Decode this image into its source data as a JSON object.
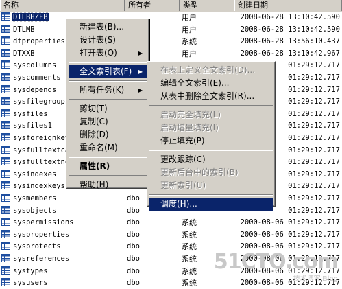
{
  "columns": [
    "名称",
    "所有者",
    "类型",
    "创建日期"
  ],
  "rows": [
    {
      "name": "DTLBHZFB",
      "owner": "",
      "type": "用户",
      "date": "2008-06-28 13:10:42.590",
      "selected": true
    },
    {
      "name": "DTLMB",
      "owner": "",
      "type": "用户",
      "date": "2008-06-28 13:10:42.590"
    },
    {
      "name": "dtproperties",
      "owner": "",
      "type": "系统",
      "date": "2008-06-28 13:56:10.437"
    },
    {
      "name": "DTXXB",
      "owner": "",
      "type": "用户",
      "date": "2008-06-28 13:10:42.967"
    },
    {
      "name": "syscolumns",
      "owner": "",
      "type": "",
      "date": "01:29:12.717"
    },
    {
      "name": "syscomments",
      "owner": "",
      "type": "",
      "date": "01:29:12.717"
    },
    {
      "name": "sysdepends",
      "owner": "",
      "type": "",
      "date": "01:29:12.717"
    },
    {
      "name": "sysfilegroups",
      "owner": "",
      "type": "",
      "date": "01:29:12.717"
    },
    {
      "name": "sysfiles",
      "owner": "",
      "type": "",
      "date": "01:29:12.717"
    },
    {
      "name": "sysfiles1",
      "owner": "",
      "type": "",
      "date": "01:29:12.717"
    },
    {
      "name": "sysforeignkey",
      "owner": "",
      "type": "",
      "date": "01:29:12.717"
    },
    {
      "name": "sysfulltextca",
      "owner": "",
      "type": "",
      "date": "01:29:12.717"
    },
    {
      "name": "sysfulltextno",
      "owner": "",
      "type": "",
      "date": "01:29:12.717"
    },
    {
      "name": "sysindexes",
      "owner": "",
      "type": "",
      "date": "01:29:12.717"
    },
    {
      "name": "sysindexkeys",
      "owner": "",
      "type": "",
      "date": "01:29:12.717"
    },
    {
      "name": "sysmembers",
      "owner": "dbo",
      "type": "",
      "date": "01:29:12.717"
    },
    {
      "name": "sysobjects",
      "owner": "dbo",
      "type": "",
      "date": "01:29:12.717"
    },
    {
      "name": "syspermissions",
      "owner": "dbo",
      "type": "系统",
      "date": "2000-08-06 01:29:12.717"
    },
    {
      "name": "sysproperties",
      "owner": "dbo",
      "type": "系统",
      "date": "2000-08-06 01:29:12.717"
    },
    {
      "name": "sysprotects",
      "owner": "dbo",
      "type": "系统",
      "date": "2000-08-06 01:29:12.717"
    },
    {
      "name": "sysreferences",
      "owner": "dbo",
      "type": "系统",
      "date": "2000-08-06 01:29:12.717"
    },
    {
      "name": "systypes",
      "owner": "dbo",
      "type": "系统",
      "date": "2000-08-06 01:29:12.717"
    },
    {
      "name": "sysusers",
      "owner": "dbo",
      "type": "系统",
      "date": "2000-08-06 01:29:12.717"
    }
  ],
  "context_menu": [
    {
      "label": "新建表(B)...",
      "type": "item"
    },
    {
      "label": "设计表(S)",
      "type": "item"
    },
    {
      "label": "打开表(O)",
      "type": "item",
      "submenu": true
    },
    {
      "type": "sep"
    },
    {
      "label": "全文索引表(F)",
      "type": "item",
      "submenu": true,
      "highlighted": true
    },
    {
      "type": "sep"
    },
    {
      "label": "所有任务(K)",
      "type": "item",
      "submenu": true
    },
    {
      "type": "sep"
    },
    {
      "label": "剪切(T)",
      "type": "item"
    },
    {
      "label": "复制(C)",
      "type": "item"
    },
    {
      "label": "删除(D)",
      "type": "item"
    },
    {
      "label": "重命名(M)",
      "type": "item"
    },
    {
      "type": "sep"
    },
    {
      "label": "属性(R)",
      "type": "item",
      "bold": true
    },
    {
      "type": "sep"
    },
    {
      "label": "帮助(H)",
      "type": "item"
    }
  ],
  "fulltext_submenu": [
    {
      "label": "在表上定义全文索引(D)...",
      "type": "item",
      "disabled": true
    },
    {
      "label": "编辑全文索引(E)...",
      "type": "item"
    },
    {
      "label": "从表中删除全文索引(R)...",
      "type": "item"
    },
    {
      "type": "sep"
    },
    {
      "label": "启动完全填充(L)",
      "type": "item",
      "disabled": true
    },
    {
      "label": "启动增量填充(I)",
      "type": "item",
      "disabled": true
    },
    {
      "label": "停止填充(P)",
      "type": "item"
    },
    {
      "type": "sep"
    },
    {
      "label": "更改跟踪(C)",
      "type": "item"
    },
    {
      "label": "更新后台中的索引(B)",
      "type": "item",
      "disabled": true
    },
    {
      "label": "更新索引(U)",
      "type": "item",
      "disabled": true
    },
    {
      "type": "sep"
    },
    {
      "label": "调度(H)...",
      "type": "item",
      "highlighted": true
    }
  ],
  "watermark": {
    "big": "51CTO.com",
    "small": "技术博客 Blog"
  },
  "colors": {
    "highlight": "#0a246a",
    "menu_bg": "#d4d0c8",
    "icon_blue": "#1f4fa0"
  }
}
